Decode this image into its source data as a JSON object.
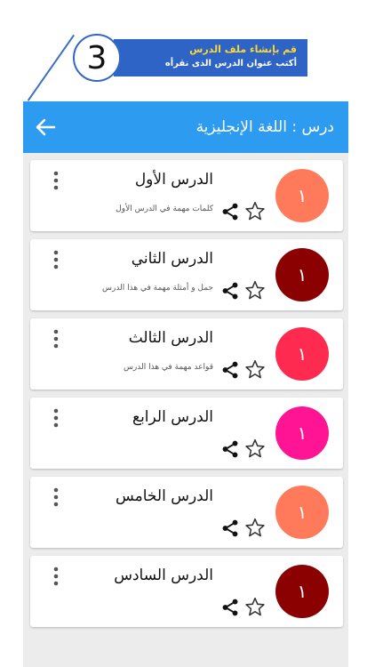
{
  "promo": {
    "step_number": "3",
    "title": "قم بإنشاء ملف الدرس",
    "subtitle": "أكتب عنوان الدرس الذى نقرأه",
    "colors": {
      "box": "#2f64c7",
      "title": "#ffd82e"
    }
  },
  "appbar": {
    "title": "درس : اللغة الإنجليزية",
    "back_icon": "arrow-left-icon",
    "color": "#2d9cf0"
  },
  "lessons": [
    {
      "number": "١",
      "title": "الدرس الأول",
      "subtitle": "كلمات مهمة في الدرس الأول",
      "color": "#ff7a5a"
    },
    {
      "number": "١",
      "title": "الدرس الثاني",
      "subtitle": "جمل و أمثلة مهمة في هذا الدرس",
      "color": "#8b0000"
    },
    {
      "number": "١",
      "title": "الدرس الثالث",
      "subtitle": "قواعد مهمة في هذا الدرس",
      "color": "#ff2a4f"
    },
    {
      "number": "١",
      "title": "الدرس الرابع",
      "subtitle": "",
      "color": "#ff1493"
    },
    {
      "number": "١",
      "title": "الدرس الخامس",
      "subtitle": "",
      "color": "#ff7a5a"
    },
    {
      "number": "١",
      "title": "الدرس السادس",
      "subtitle": "",
      "color": "#8b0000"
    }
  ],
  "icons": {
    "favorite": "star-outline-icon",
    "share": "share-icon",
    "menu": "more-vert-icon"
  }
}
